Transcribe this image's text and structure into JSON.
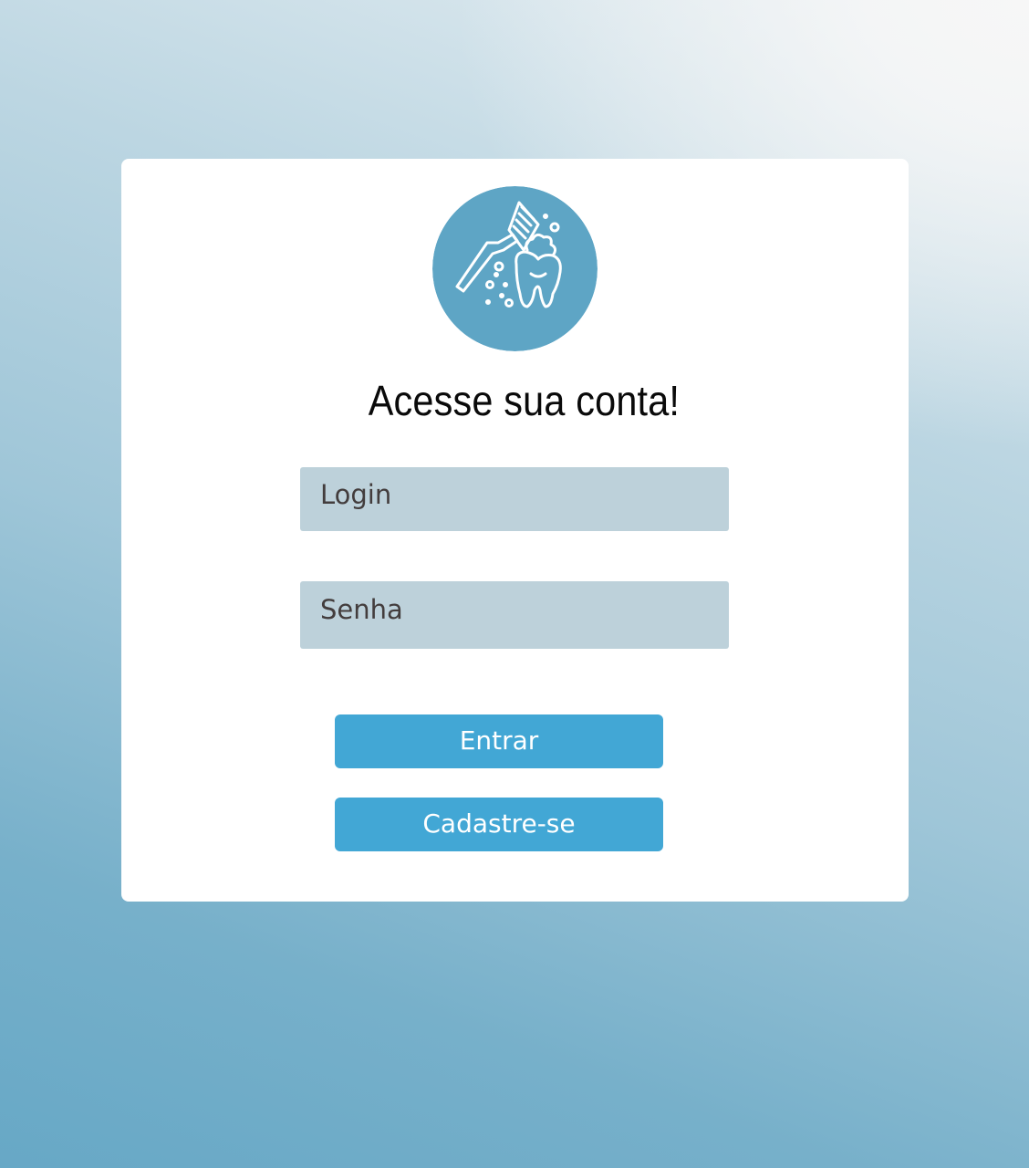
{
  "logo": {
    "icon": "toothbrush-tooth-icon",
    "background_color": "#5ea5c5"
  },
  "title": "Acesse sua conta!",
  "form": {
    "login_placeholder": "Login",
    "password_placeholder": "Senha"
  },
  "buttons": {
    "entrar_label": "Entrar",
    "cadastre_label": "Cadastre-se",
    "color": "#42a7d5"
  }
}
